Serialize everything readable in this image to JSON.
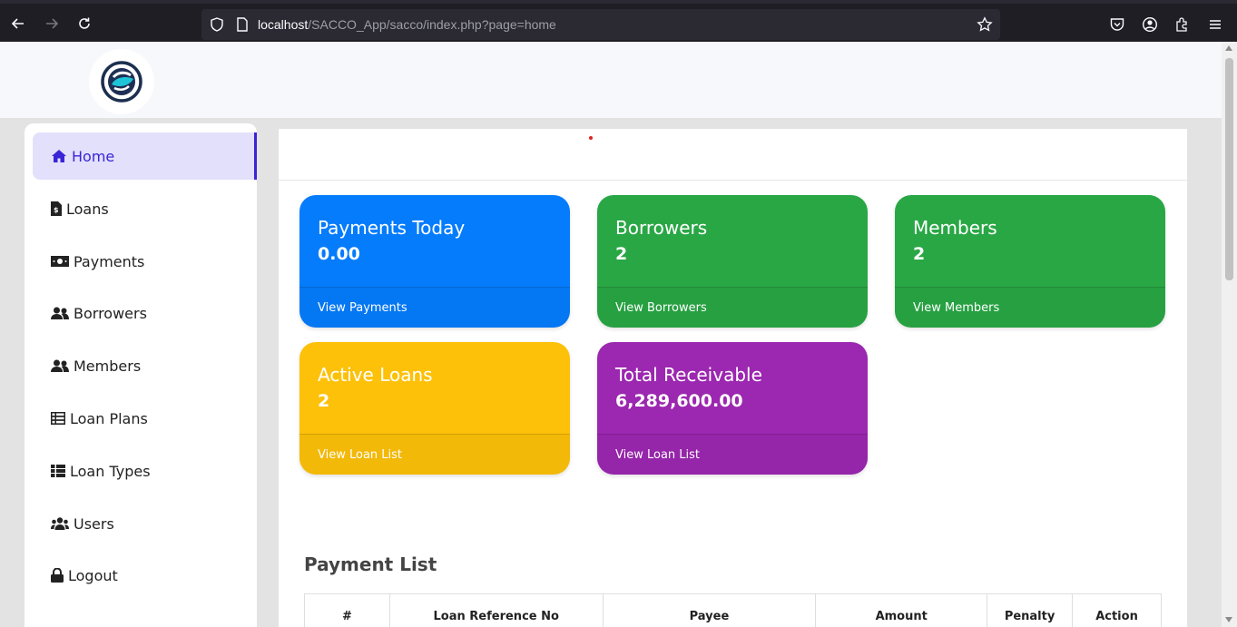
{
  "browser": {
    "url_host": "localhost",
    "url_path": "/SACCO_App/sacco/index.php?page=home",
    "icons": [
      "back-arrow-icon",
      "forward-arrow-icon",
      "reload-icon",
      "shield-icon",
      "page-icon",
      "star-icon",
      "pocket-icon",
      "account-icon",
      "extensions-icon",
      "menu-icon"
    ]
  },
  "sidebar": {
    "items": [
      {
        "label": "Home",
        "icon": "home-icon",
        "active": true
      },
      {
        "label": "Loans",
        "icon": "file-invoice-icon"
      },
      {
        "label": "Payments",
        "icon": "money-bill-icon"
      },
      {
        "label": "Borrowers",
        "icon": "user-friends-icon"
      },
      {
        "label": "Members",
        "icon": "user-friends-icon"
      },
      {
        "label": "Loan Plans",
        "icon": "list-icon"
      },
      {
        "label": "Loan Types",
        "icon": "th-list-icon"
      },
      {
        "label": "Users",
        "icon": "users-icon"
      },
      {
        "label": "Logout",
        "icon": "lock-icon"
      }
    ]
  },
  "cards": [
    {
      "title": "Payments Today",
      "value": "0.00",
      "link": "View Payments",
      "color": "#057cfc"
    },
    {
      "title": "Borrowers",
      "value": "2",
      "link": "View Borrowers",
      "color": "#29a745"
    },
    {
      "title": "Members",
      "value": "2",
      "link": "View Members",
      "color": "#29a745"
    },
    {
      "title": "Active Loans",
      "value": "2",
      "link": "View Loan List",
      "color": "#fdc10a"
    },
    {
      "title": "Total Receivable",
      "value": "6,289,600.00",
      "link": "View Loan List",
      "color": "#9c27b0"
    }
  ],
  "payment_list": {
    "title": "Payment List",
    "columns": [
      "#",
      "Loan Reference No",
      "Payee",
      "Amount",
      "Penalty",
      "Action"
    ]
  }
}
